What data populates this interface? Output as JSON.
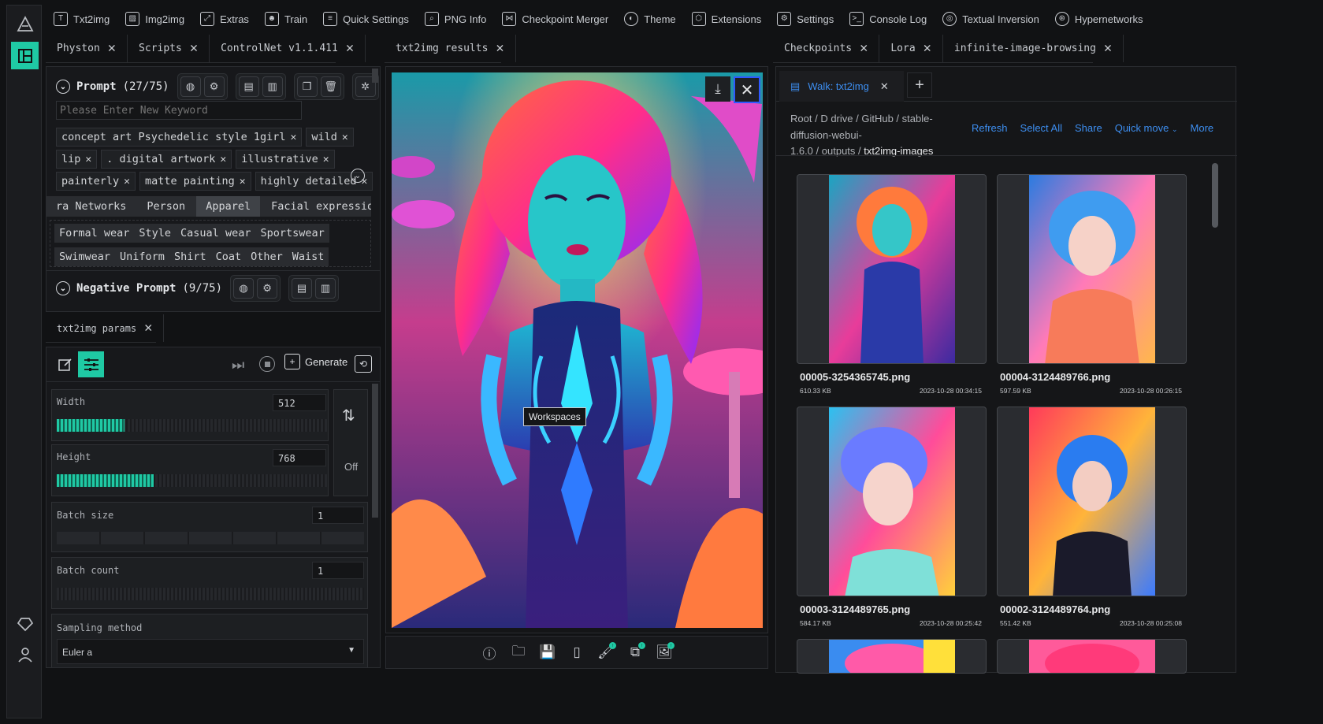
{
  "nav": {
    "items": [
      {
        "label": "Txt2img",
        "icon": "text-box-icon"
      },
      {
        "label": "Img2img",
        "icon": "image-icon"
      },
      {
        "label": "Extras",
        "icon": "expand-icon"
      },
      {
        "label": "Train",
        "icon": "robot-icon"
      },
      {
        "label": "Quick Settings",
        "icon": "sliders-icon"
      },
      {
        "label": "PNG Info",
        "icon": "image-search-icon"
      },
      {
        "label": "Checkpoint Merger",
        "icon": "merge-icon"
      },
      {
        "label": "Theme",
        "icon": "drop-icon"
      },
      {
        "label": "Extensions",
        "icon": "cube-icon"
      },
      {
        "label": "Settings",
        "icon": "gear-icon"
      },
      {
        "label": "Console Log",
        "icon": "terminal-icon"
      },
      {
        "label": "Textual Inversion",
        "icon": "target-icon"
      },
      {
        "label": "Hypernetworks",
        "icon": "network-icon"
      }
    ]
  },
  "left_tabs": [
    "Physton",
    "Scripts",
    "ControlNet v1.1.411"
  ],
  "center_tabs": [
    "txt2img results"
  ],
  "right_tabs": [
    "Checkpoints",
    "Lora",
    "infinite-image-browsing"
  ],
  "prompt": {
    "title": "Prompt",
    "count": "(27/75)",
    "keyword_placeholder": "Please Enter New Keyword",
    "chips_row1": [
      "concept art Psychedelic style 1girl",
      "wild"
    ],
    "chips_row2": [
      "lip",
      ". digital artwork",
      "illustrative"
    ],
    "chips_row3": [
      "painterly",
      "matte painting",
      "highly detailed"
    ],
    "categories": [
      "ra Networks",
      "Person",
      "Apparel",
      "Facial expression and"
    ],
    "subcats_row1": [
      "Formal wear",
      "Style",
      "Casual wear",
      "Sportswear"
    ],
    "subcats_row2": [
      "Swimwear",
      "Uniform",
      "Shirt",
      "Coat",
      "Other",
      "Waist"
    ]
  },
  "negative": {
    "title": "Negative Prompt",
    "count": "(9/75)"
  },
  "params_tab": "txt2img params",
  "toolbar": {
    "generate_label": "Generate"
  },
  "params": {
    "width_label": "Width",
    "width_value": "512",
    "width_fraction": 0.25,
    "height_label": "Height",
    "height_value": "768",
    "height_fraction": 0.36,
    "swap_off_label": "Off",
    "batch_size_label": "Batch size",
    "batch_size_value": "1",
    "batch_count_label": "Batch count",
    "batch_count_value": "1",
    "sampling_label": "Sampling method",
    "sampling_value": "Euler a"
  },
  "tooltip": "Workspaces",
  "browser": {
    "tab_label": "Walk: txt2img",
    "breadcrumb": [
      "Root",
      "D drive",
      "GitHub",
      "stable-",
      "diffusion-webui-",
      "1.6.0",
      "outputs",
      "txt2img-images"
    ],
    "actions": [
      "Refresh",
      "Select All",
      "Share",
      "Quick move",
      "More"
    ],
    "files": [
      {
        "name": "00005-3254365745.png",
        "size": "610.33 KB",
        "date": "2023-10-28 00:34:15"
      },
      {
        "name": "00004-3124489766.png",
        "size": "597.59 KB",
        "date": "2023-10-28 00:26:15"
      },
      {
        "name": "00003-3124489765.png",
        "size": "584.17 KB",
        "date": "2023-10-28 00:25:42"
      },
      {
        "name": "00002-3124489764.png",
        "size": "551.42 KB",
        "date": "2023-10-28 00:25:08"
      }
    ]
  },
  "colors": {
    "accent": "#1fc9a4",
    "link": "#3d8ef0"
  }
}
